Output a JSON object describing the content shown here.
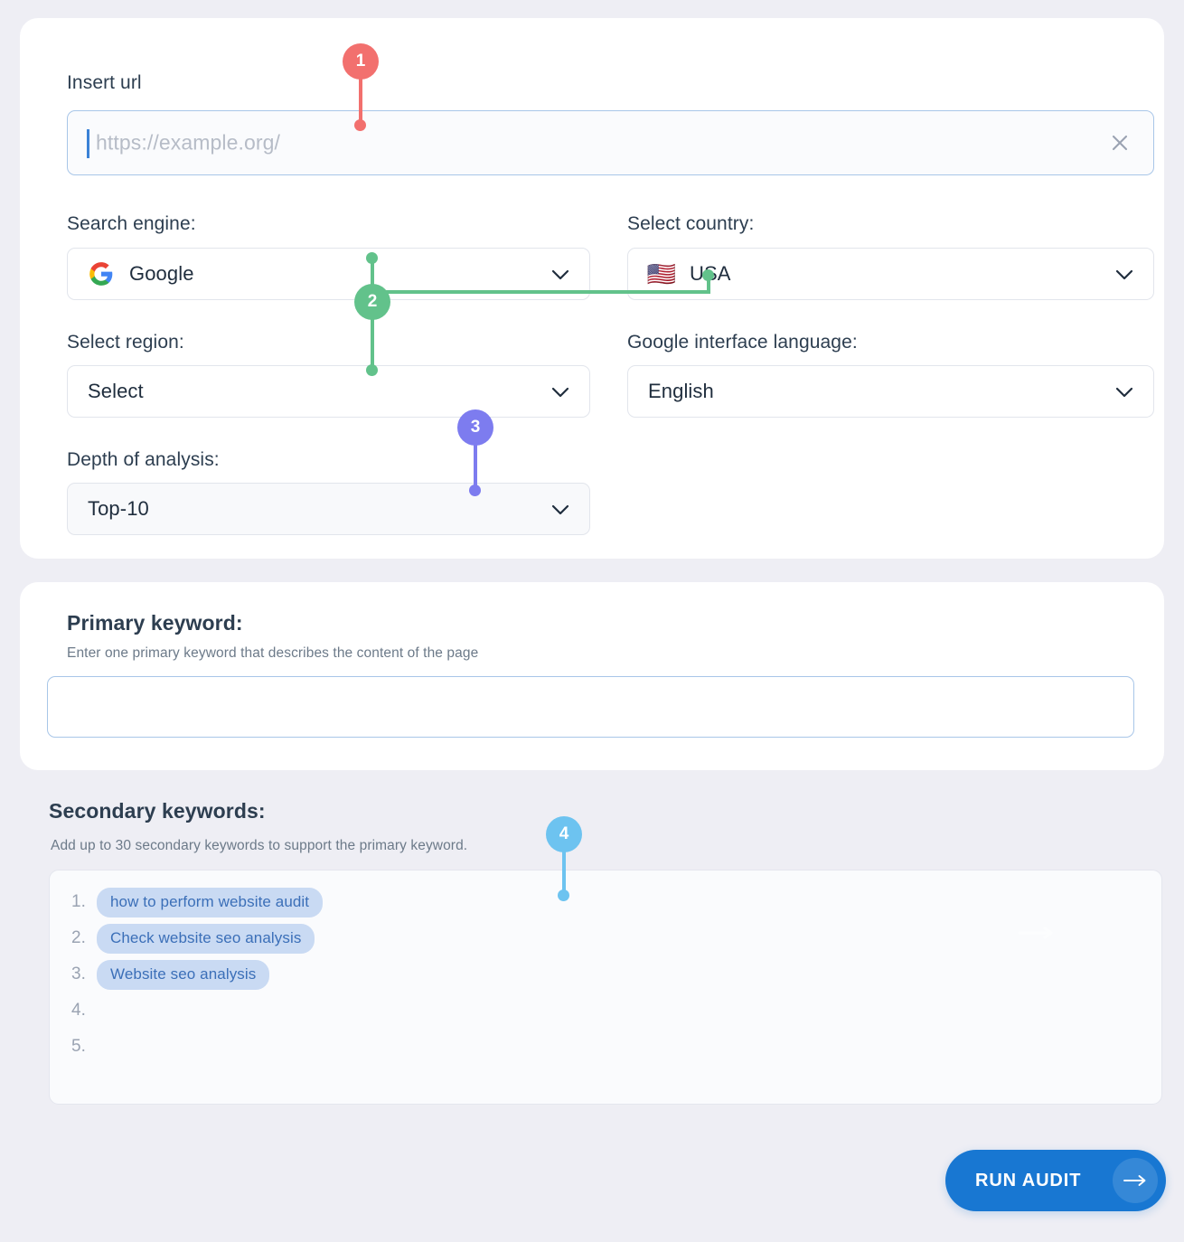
{
  "colors": {
    "page_bg": "#eeeef4",
    "card_bg": "#ffffff",
    "accent_blue": "#1877d2",
    "callout_1": "#f2706e",
    "callout_2": "#62c28b",
    "callout_3": "#7d7cef",
    "callout_4": "#6dc3f0",
    "chip_bg": "#c9daf3",
    "chip_text": "#3b6fb8",
    "input_border": "#a8c6e8",
    "label_text": "#2d3e50"
  },
  "url_field": {
    "label": "Insert url",
    "value": "",
    "placeholder": "https://example.org/",
    "clear_icon": "close-icon"
  },
  "search_engine": {
    "label": "Search engine:",
    "value": "Google",
    "icon": "google-logo-icon",
    "chevron": "chevron-down-icon"
  },
  "country": {
    "label": "Select country:",
    "value": "USA",
    "icon": "usa-flag-icon",
    "flag": "🇺🇸",
    "chevron": "chevron-down-icon"
  },
  "region": {
    "label": "Select region:",
    "value": "Select",
    "chevron": "chevron-down-icon"
  },
  "interface_language": {
    "label": "Google interface language:",
    "value": "English",
    "chevron": "chevron-down-icon"
  },
  "depth": {
    "label": "Depth of analysis:",
    "value": "Top-10",
    "chevron": "chevron-down-icon"
  },
  "primary_keyword": {
    "title": "Primary keyword:",
    "hint": "Enter one primary keyword that describes the content of the page",
    "value": "",
    "placeholder": ""
  },
  "secondary_keywords": {
    "title": "Secondary keywords:",
    "hint": "Add up to 30 secondary keywords to support the primary keyword.",
    "rows": [
      {
        "num": "1.",
        "text": "how to perform website audit"
      },
      {
        "num": "2.",
        "text": "Check website seo analysis"
      },
      {
        "num": "3.",
        "text": "Website seo analysis"
      },
      {
        "num": "4.",
        "text": ""
      },
      {
        "num": "5.",
        "text": ""
      }
    ]
  },
  "run_audit": {
    "label": "RUN AUDIT",
    "arrow_icon": "arrow-right-icon"
  },
  "callouts": [
    {
      "id": "1",
      "number": "1",
      "color": "#f2706e"
    },
    {
      "id": "2",
      "number": "2",
      "color": "#62c28b"
    },
    {
      "id": "3",
      "number": "3",
      "color": "#7d7cef"
    },
    {
      "id": "4",
      "number": "4",
      "color": "#6dc3f0"
    }
  ]
}
